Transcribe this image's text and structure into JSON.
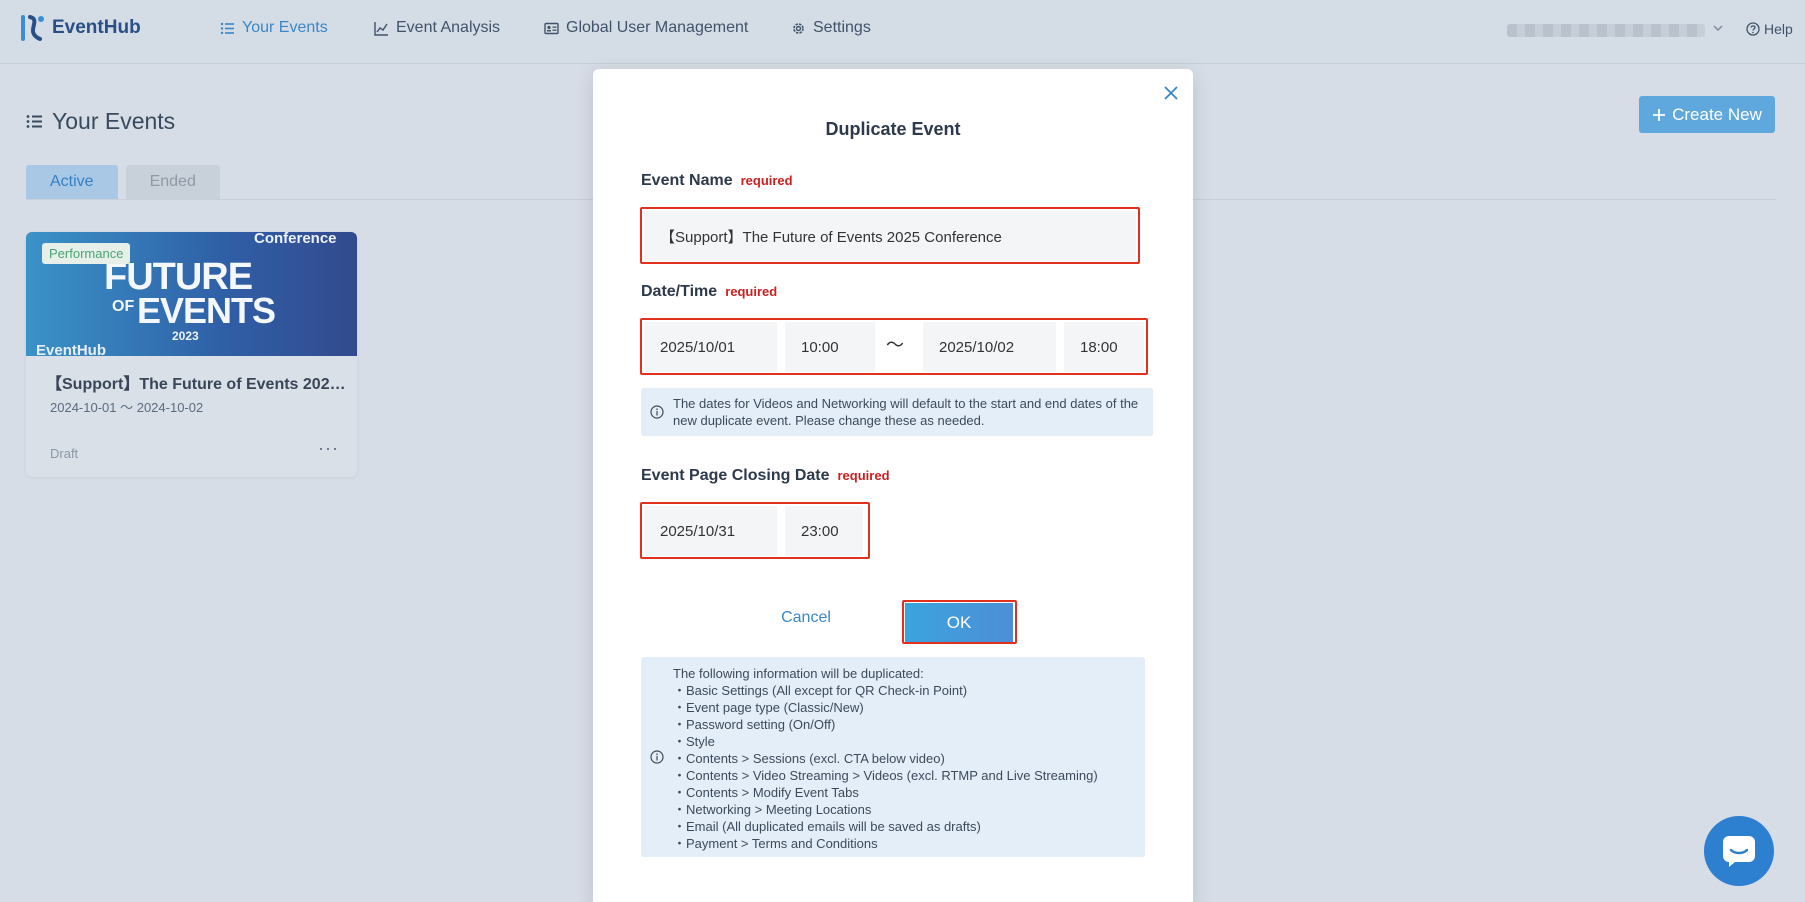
{
  "app": {
    "logo_text": "EventHub",
    "accent": "#3a86c8",
    "highlight": "#e2301f"
  },
  "nav": {
    "items": [
      {
        "label": "Your Events",
        "icon": "list-icon",
        "active": true
      },
      {
        "label": "Event Analysis",
        "icon": "chart-icon",
        "active": false
      },
      {
        "label": "Global User Management",
        "icon": "id-card-icon",
        "active": false
      },
      {
        "label": "Settings",
        "icon": "gear-icon",
        "active": false
      }
    ],
    "help_label": "Help"
  },
  "page": {
    "title": "Your Events",
    "create_label": "Create New",
    "tabs": [
      {
        "label": "Active",
        "active": true
      },
      {
        "label": "Ended",
        "active": false
      }
    ]
  },
  "card": {
    "badge": "Performance",
    "banner": {
      "conference": "Conference",
      "future": "FUTURE",
      "of": "OF",
      "events": "EVENTS",
      "year": "2023",
      "brand": "EventHub"
    },
    "title": "【Support】The Future of Events 2025 Conference",
    "dates": "2024-10-01 〜 2024-10-02",
    "status": "Draft",
    "more": "···"
  },
  "modal": {
    "title": "Duplicate Event",
    "required_label": "required",
    "event_name": {
      "label": "Event Name",
      "value": "【Support】The Future of Events 2025 Conference"
    },
    "datetime": {
      "label": "Date/Time",
      "start_date": "2025/10/01",
      "start_time": "10:00",
      "separator": "〜",
      "end_date": "2025/10/02",
      "end_time": "18:00",
      "notice": "The dates for Videos and Networking will default to the start and end dates of the new duplicate event.  Please change these as needed."
    },
    "closing": {
      "label": "Event Page Closing Date",
      "date": "2025/10/31",
      "time": "23:00"
    },
    "cancel_label": "Cancel",
    "ok_label": "OK",
    "duplicated": {
      "heading": "The following information will be duplicated:",
      "items": [
        "・Basic Settings (All except for QR Check-in Point)",
        "・Event page type (Classic/New)",
        "・Password setting (On/Off)",
        "・Style",
        "・Contents > Sessions (excl. CTA below video)",
        "・Contents > Video Streaming >  Videos (excl. RTMP and Live Streaming)",
        "・Contents > Modify Event Tabs",
        "・Networking > Meeting Locations",
        "・Email (All duplicated emails will be saved as drafts)",
        "・Payment > Terms and Conditions"
      ]
    }
  }
}
